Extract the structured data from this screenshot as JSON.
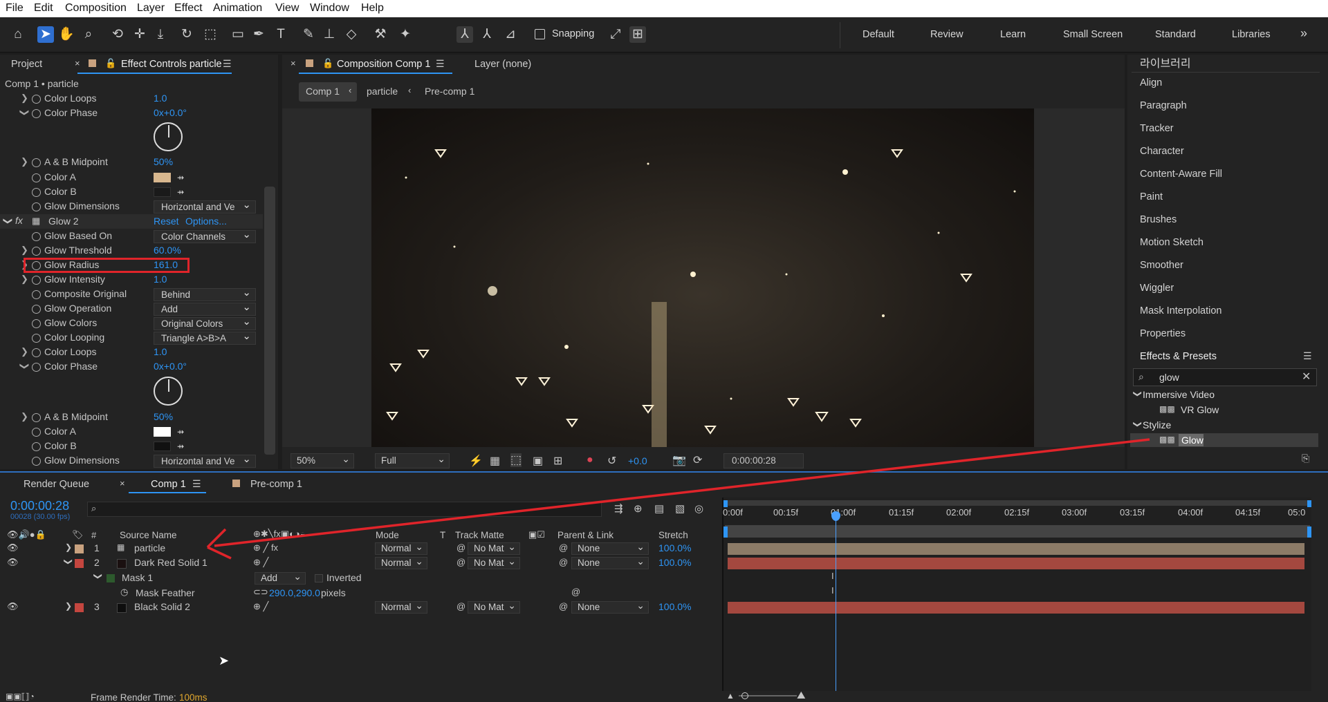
{
  "menu": [
    "File",
    "Edit",
    "Composition",
    "Layer",
    "Effect",
    "Animation",
    "View",
    "Window",
    "Help"
  ],
  "toolbar": {
    "snapping_label": "Snapping",
    "workspaces": [
      "Default",
      "Review",
      "Learn",
      "Small Screen",
      "Standard",
      "Libraries"
    ],
    "more": "»"
  },
  "left_panel": {
    "tab_project": "Project",
    "tab_effect_controls": "Effect Controls particle",
    "breadcrumb": "Comp 1 • particle",
    "glow2_label": "Glow 2",
    "reset": "Reset",
    "options": "Options...",
    "rows_top": [
      {
        "name": "Color Loops",
        "value": "1.0"
      },
      {
        "name": "Color Phase",
        "value": "0x+0.0°"
      },
      {
        "name": "A & B Midpoint",
        "value": "50%"
      },
      {
        "name": "Color A"
      },
      {
        "name": "Color B"
      },
      {
        "name": "Glow Dimensions",
        "value": "Horizontal and Ve"
      }
    ],
    "rows_glow2": [
      {
        "name": "Glow Based On",
        "value": "Color Channels"
      },
      {
        "name": "Glow Threshold",
        "value": "60.0%"
      },
      {
        "name": "Glow Radius",
        "value": "161.0"
      },
      {
        "name": "Glow Intensity",
        "value": "1.0"
      },
      {
        "name": "Composite Original",
        "value": "Behind"
      },
      {
        "name": "Glow Operation",
        "value": "Add"
      },
      {
        "name": "Glow Colors",
        "value": "Original Colors"
      },
      {
        "name": "Color Looping",
        "value": "Triangle A>B>A"
      },
      {
        "name": "Color Loops",
        "value": "1.0"
      },
      {
        "name": "Color Phase",
        "value": "0x+0.0°"
      },
      {
        "name": "A & B Midpoint",
        "value": "50%"
      },
      {
        "name": "Color A"
      },
      {
        "name": "Color B"
      },
      {
        "name": "Glow Dimensions",
        "value": "Horizontal and Ve"
      }
    ],
    "colors": {
      "color_a_top": "#d8b78e",
      "color_b_top": "#1a1a1a",
      "color_a_bottom": "#ffffff",
      "color_b_bottom": "#111111"
    }
  },
  "comp_panel": {
    "tab_comp": "Composition Comp 1",
    "tab_layer": "Layer (none)",
    "crumbs": [
      "Comp 1",
      "particle",
      "Pre-comp 1"
    ],
    "zoom": "50%",
    "resolution": "Full",
    "exposure": "+0.0",
    "timecode": "0:00:00:28"
  },
  "right_panel": {
    "items": [
      "라이브러리",
      "Align",
      "Paragraph",
      "Tracker",
      "Character",
      "Content-Aware Fill",
      "Paint",
      "Brushes",
      "Motion Sketch",
      "Smoother",
      "Wiggler",
      "Mask Interpolation",
      "Properties"
    ],
    "effects_title": "Effects & Presets",
    "search_value": "glow",
    "cat1": "Immersive Video",
    "cat1_item": "VR Glow",
    "cat2": "Stylize",
    "cat2_item": "Glow"
  },
  "timeline": {
    "tab_render": "Render Queue",
    "tab_comp": "Comp 1",
    "tab_precomp": "Pre-comp 1",
    "timecode": "0:00:00:28",
    "fps": "00028 (30.00 fps)",
    "col_source": "Source Name",
    "col_mode": "Mode",
    "col_t": "T",
    "col_matte": "Track Matte",
    "col_parent": "Parent & Link",
    "col_stretch": "Stretch",
    "layers": [
      {
        "num": "1",
        "name": "particle",
        "mode": "Normal",
        "matte": "No Mat",
        "parent": "None",
        "stretch": "100.0%",
        "color": "#c9a27f"
      },
      {
        "num": "2",
        "name": "Dark Red Solid 1",
        "mode": "Normal",
        "matte": "No Mat",
        "parent": "None",
        "stretch": "100.0%",
        "color": "#c4463f"
      },
      {
        "num": "3",
        "name": "Black Solid 2",
        "mode": "Normal",
        "matte": "No Mat",
        "parent": "None",
        "stretch": "100.0%",
        "color": "#c4463f"
      }
    ],
    "mask": {
      "name": "Mask 1",
      "mode": "Add",
      "inverted": "Inverted",
      "feather_label": "Mask Feather",
      "feather_value": "290.0,290.0",
      "feather_unit": "pixels"
    },
    "ruler": [
      "0:00f",
      "00:15f",
      "01:00f",
      "01:15f",
      "02:00f",
      "02:15f",
      "03:00f",
      "03:15f",
      "04:00f",
      "04:15f",
      "05:0"
    ],
    "footer_label": "Frame Render Time:",
    "footer_value": "100ms"
  }
}
